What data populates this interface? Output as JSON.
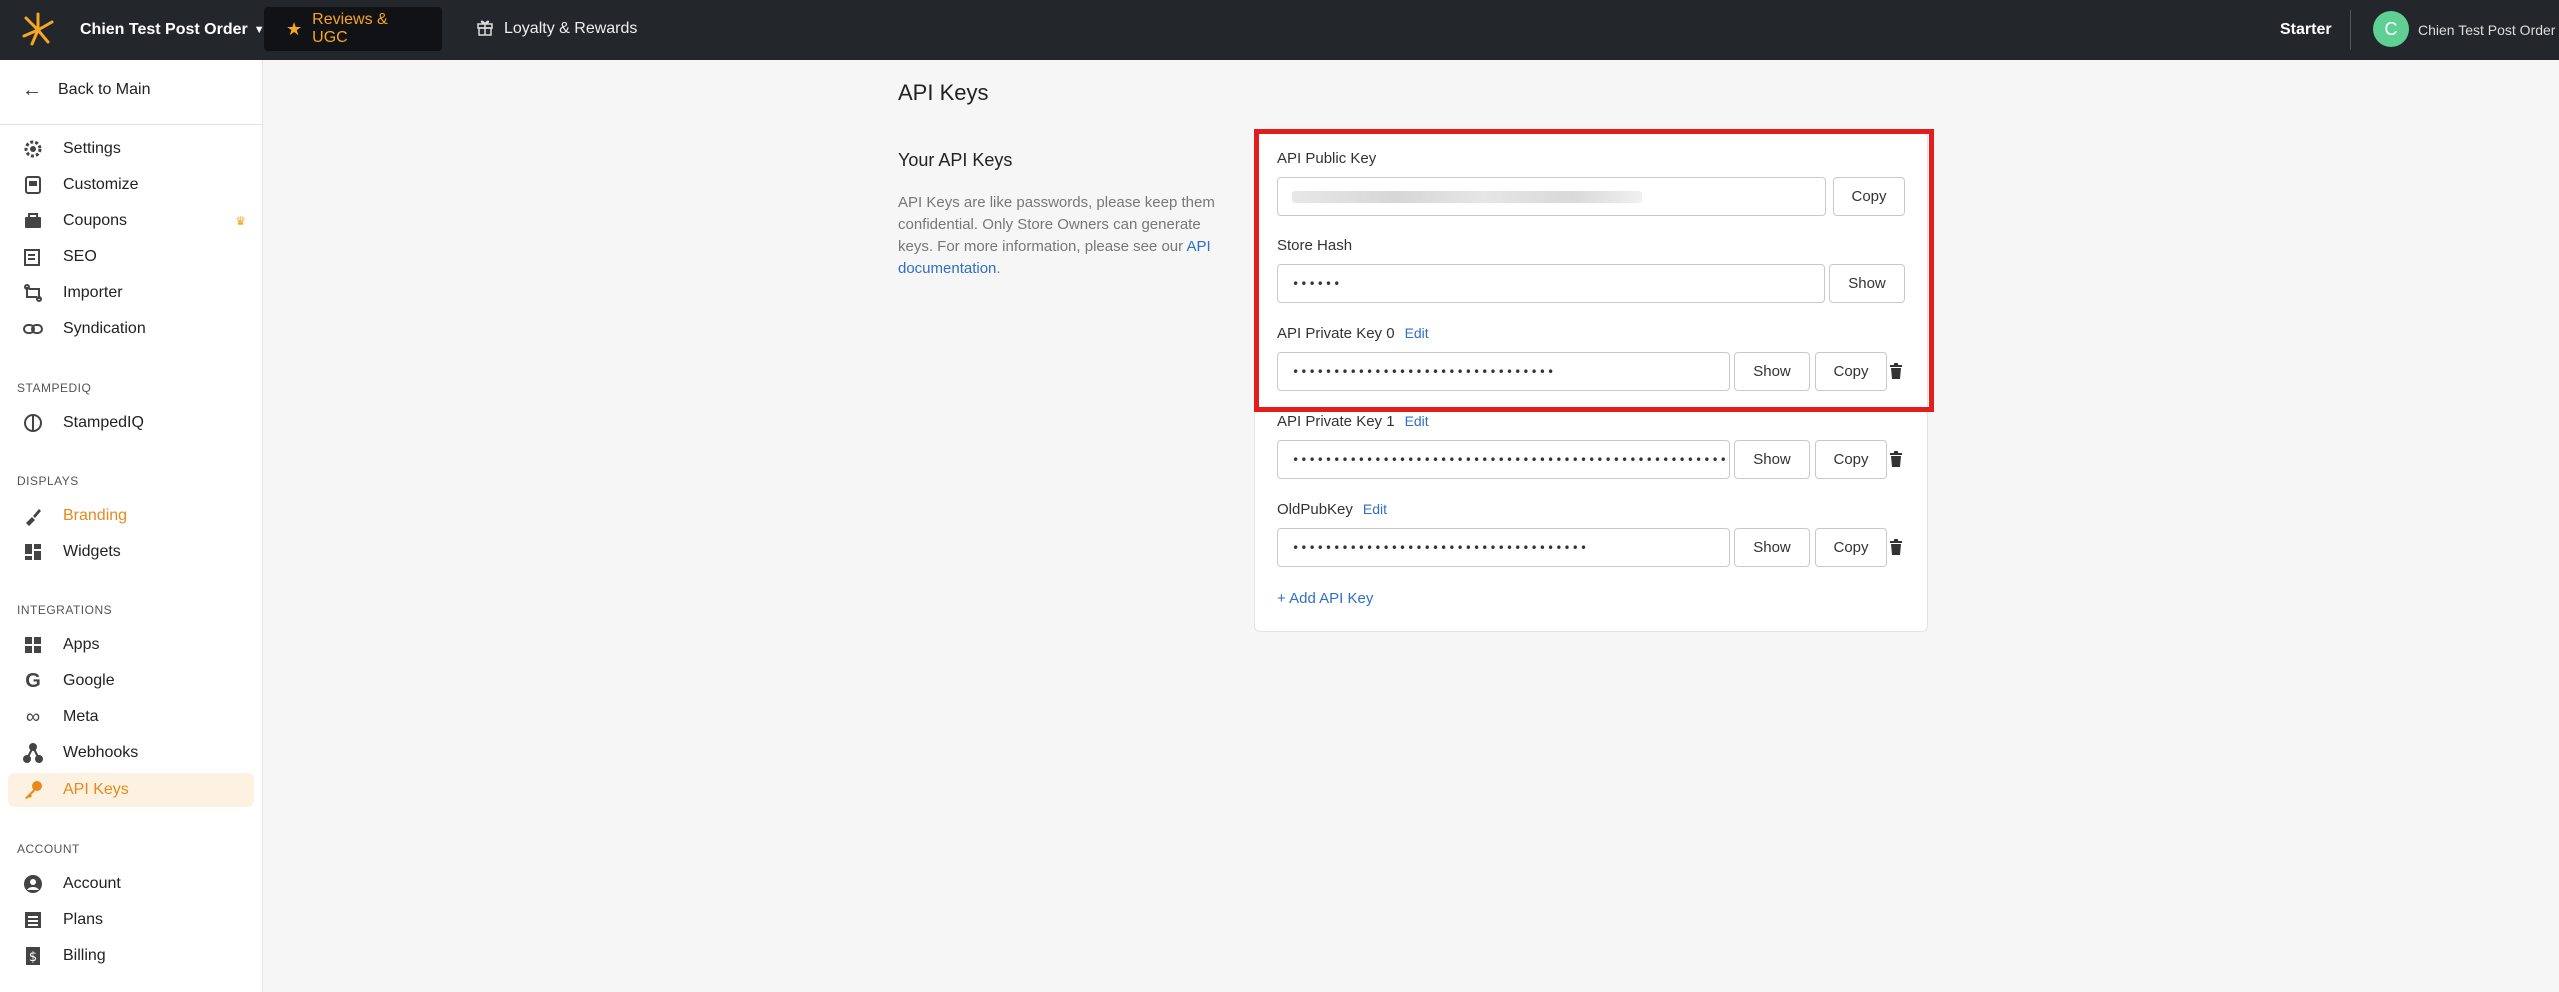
{
  "topbar": {
    "store_name": "Chien Test Post Order",
    "tabs": [
      {
        "label": "Reviews & UGC",
        "icon": "star-icon"
      },
      {
        "label": "Loyalty & Rewards",
        "icon": "gift-icon"
      }
    ],
    "plan": "Starter",
    "avatar_letter": "C",
    "user_name": "Chien Test Post Order"
  },
  "sidebar": {
    "back_label": "Back to Main",
    "items": [
      {
        "label": "Settings",
        "icon": "gear-icon"
      },
      {
        "label": "Customize",
        "icon": "customize-icon"
      },
      {
        "label": "Coupons",
        "icon": "coupons-icon"
      },
      {
        "label": "SEO",
        "icon": "seo-icon"
      },
      {
        "label": "Importer",
        "icon": "importer-icon"
      },
      {
        "label": "Syndication",
        "icon": "link-icon"
      }
    ],
    "sections": {
      "stampediq": {
        "title": "STAMPEDIQ",
        "items": [
          {
            "label": "StampedIQ",
            "icon": "stampediq-icon"
          }
        ]
      },
      "displays": {
        "title": "DISPLAYS",
        "items": [
          {
            "label": "Branding",
            "icon": "branding-icon"
          },
          {
            "label": "Widgets",
            "icon": "widgets-icon"
          }
        ]
      },
      "integrations": {
        "title": "INTEGRATIONS",
        "items": [
          {
            "label": "Apps",
            "icon": "apps-icon"
          },
          {
            "label": "Google",
            "icon": "google-icon"
          },
          {
            "label": "Meta",
            "icon": "meta-icon"
          },
          {
            "label": "Webhooks",
            "icon": "webhooks-icon"
          },
          {
            "label": "API Keys",
            "icon": "key-icon"
          }
        ]
      },
      "account": {
        "title": "ACCOUNT",
        "items": [
          {
            "label": "Account",
            "icon": "account-icon"
          },
          {
            "label": "Plans",
            "icon": "plans-icon"
          },
          {
            "label": "Billing",
            "icon": "billing-icon"
          }
        ]
      }
    }
  },
  "main": {
    "title": "API Keys",
    "section_title": "Your API Keys",
    "description": "API Keys are like passwords, please keep them confidential. Only Store Owners can generate keys. For more information, please see our ",
    "doc_link": "API documentation",
    "description_end": ".",
    "fields": {
      "public_key": {
        "label": "API Public Key",
        "value": ""
      },
      "store_hash": {
        "label": "Store Hash",
        "value": "••••••"
      },
      "private_key_0": {
        "label": "API Private Key 0",
        "value": "••••••••••••••••••••••••••••••••"
      },
      "private_key_1": {
        "label": "API Private Key 1",
        "value": "••••••••••••••••••••••••••••••••••••••••••••••••••••••••••••••"
      },
      "old_pub_key": {
        "label": "OldPubKey",
        "value": "••••••••••••••••••••••••••••••••••••"
      }
    },
    "edit_label": "Edit",
    "copy_label": "Copy",
    "show_label": "Show",
    "add_key_label": "+ Add API Key"
  },
  "colors": {
    "accent": "#e8891c",
    "link": "#2f6fc5",
    "highlight": "#e11d1d",
    "topbar": "#23262b"
  }
}
